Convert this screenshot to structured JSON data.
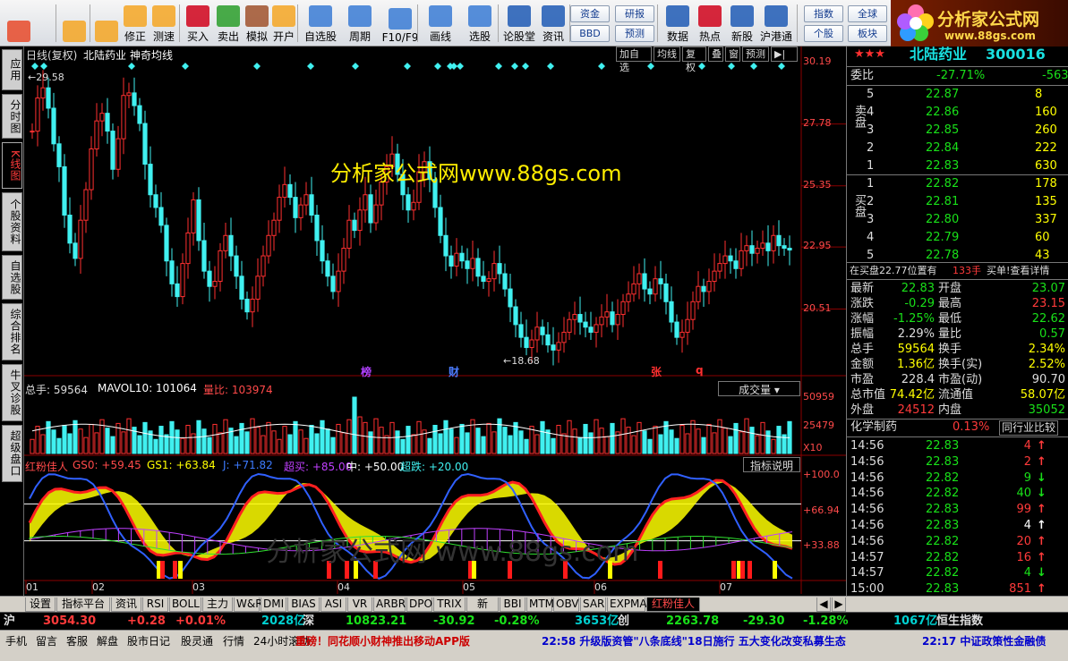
{
  "toolbar": {
    "buttons": [
      {
        "label": "",
        "icon": "grid-icon"
      },
      {
        "label": "",
        "icon": "back-arrow-icon"
      },
      {
        "label": "",
        "icon": "up-down-arrows-icon"
      },
      {
        "label": "修正",
        "icon": "refresh-icon"
      },
      {
        "label": "测速",
        "icon": "clock-icon"
      },
      {
        "label": "买入",
        "icon": "buy-icon"
      },
      {
        "label": "卖出",
        "icon": "sell-icon"
      },
      {
        "label": "模拟",
        "icon": "hammer-icon"
      },
      {
        "label": "开户",
        "icon": "lock-icon"
      },
      {
        "label": "自选股",
        "icon": "star-icon"
      },
      {
        "label": "周期",
        "icon": "period-clock-icon"
      },
      {
        "label": "F10/F9",
        "icon": "f10-icon"
      },
      {
        "label": "画线",
        "icon": "pen-icon"
      },
      {
        "label": "选股",
        "icon": "select-stock-icon"
      },
      {
        "label": "论股堂",
        "icon": "forum-icon"
      },
      {
        "label": "资讯",
        "icon": "news-icon"
      },
      {
        "label": "数据",
        "icon": "pe-icon"
      },
      {
        "label": "热点",
        "icon": "hot-icon"
      },
      {
        "label": "新股",
        "icon": "new-stock-icon"
      },
      {
        "label": "沪港通",
        "icon": "sse-hk-icon"
      }
    ],
    "quick": [
      "资金",
      "研报",
      "BBD",
      "预测",
      "指数",
      "全球",
      "个股",
      "板块"
    ]
  },
  "logo": {
    "title": "分析家公式网",
    "url": "www.88gs.com"
  },
  "side_tabs": [
    "应用",
    "分时图",
    "K线图",
    "个股资料",
    "自选股",
    "综合排名",
    "牛叉诊股",
    "超级盘口"
  ],
  "chart_header": {
    "mode": "日线(复权)",
    "stock": "北陆药业",
    "indicator": "神奇均线",
    "buttons": [
      "加自选",
      "均线",
      "复权",
      "叠",
      "窗",
      "预测"
    ]
  },
  "watermark": "分析家公式网www.88gs.com",
  "watermark2": "分析家公式网  www.88gs.com",
  "price_axis": [
    "30.19",
    "27.78",
    "25.35",
    "22.95",
    "20.51"
  ],
  "price_marks": {
    "high": "29.58",
    "low": "18.68"
  },
  "event_marks": [
    {
      "t": "榜",
      "color": "#b040ff"
    },
    {
      "t": "财",
      "color": "#4a7bff"
    },
    {
      "t": "张",
      "color": "#ff3030"
    },
    {
      "t": "q",
      "color": "#ff3030"
    }
  ],
  "volume_header": {
    "total": "总手: 59564",
    "mavol": "MAVOL10: 101064",
    "ratio": "量比: 103974",
    "dropdown": "成交量"
  },
  "volume_axis": [
    "50959",
    "25479",
    "X10"
  ],
  "ind_header": {
    "name": "红粉佳人",
    "gs0": "GS0: +59.45",
    "gs1": "GS1: +63.84",
    "j": "J: +71.82",
    "chao": "超买: +85.00",
    "mid": "中: +50.00",
    "chaodie": "超跌: +20.00",
    "help": "指标说明"
  },
  "ind_axis": [
    "+100.0",
    "+66.94",
    "+33.88"
  ],
  "months": [
    "01",
    "02",
    "03",
    "04",
    "05",
    "06",
    "07"
  ],
  "quote": {
    "stars": "★★★",
    "name": "北陆药业",
    "code": "300016",
    "webi_label": "委比",
    "webi": "-27.71%",
    "webi2": "-563",
    "sell_label": "卖盘",
    "buy_label": "买盘",
    "sell": [
      [
        "5",
        "22.87",
        "8"
      ],
      [
        "4",
        "22.86",
        "160"
      ],
      [
        "3",
        "22.85",
        "260"
      ],
      [
        "2",
        "22.84",
        "222"
      ],
      [
        "1",
        "22.83",
        "630"
      ]
    ],
    "buy": [
      [
        "1",
        "22.82",
        "178"
      ],
      [
        "2",
        "22.81",
        "135"
      ],
      [
        "3",
        "22.80",
        "337"
      ],
      [
        "4",
        "22.79",
        "60"
      ],
      [
        "5",
        "22.78",
        "43"
      ]
    ],
    "note": "在买盘22.77位置有",
    "note_val": "133手",
    "note2": "买单!查看详情",
    "stats": [
      [
        "最新",
        "22.83",
        "开盘",
        "23.07"
      ],
      [
        "涨跌",
        "-0.29",
        "最高",
        "23.15"
      ],
      [
        "涨幅",
        "-1.25%",
        "最低",
        "22.62"
      ],
      [
        "振幅",
        "2.29%",
        "量比",
        "0.57"
      ],
      [
        "总手",
        "59564",
        "换手",
        "2.34%"
      ],
      [
        "金额",
        "1.36亿",
        "换手(实)",
        "2.52%"
      ],
      [
        "市盈",
        "228.4",
        "市盈(动)",
        "90.70"
      ],
      [
        "总市值",
        "74.42亿",
        "流通值",
        "58.07亿"
      ],
      [
        "外盘",
        "24512",
        "内盘",
        "35052"
      ]
    ],
    "sector": "化学制药",
    "sector_pct": "0.13%",
    "sector_cmp": "同行业比较",
    "ticks": [
      [
        "14:56",
        "22.83",
        "4",
        "up"
      ],
      [
        "14:56",
        "22.83",
        "2",
        "up"
      ],
      [
        "14:56",
        "22.82",
        "9",
        "down"
      ],
      [
        "14:56",
        "22.82",
        "40",
        "down"
      ],
      [
        "14:56",
        "22.83",
        "99",
        "up"
      ],
      [
        "14:56",
        "22.83",
        "4",
        "flat"
      ],
      [
        "14:56",
        "22.82",
        "20",
        "up"
      ],
      [
        "14:57",
        "22.82",
        "16",
        "up"
      ],
      [
        "14:57",
        "22.82",
        "4",
        "down"
      ],
      [
        "15:00",
        "22.83",
        "851",
        "up"
      ]
    ],
    "bottom_tabs": [
      "细",
      "诊",
      "分",
      "筹",
      "怡",
      "财"
    ]
  },
  "bottom_tabs": [
    "设置",
    "指标平台",
    "资讯",
    "RSI",
    "BOLL",
    "主力",
    "W&R",
    "DMI",
    "BIAS",
    "ASI",
    "VR",
    "ARBR",
    "DPO",
    "TRIX",
    "新DMA",
    "BBI",
    "MTM",
    "OBV",
    "SAR",
    "EXPMA",
    "红粉佳人"
  ],
  "index_bar": {
    "sh": "沪",
    "sh_val": "3054.30",
    "sh_chg": "+0.28",
    "sh_pct": "+0.01%",
    "sh_amt": "2028亿",
    "sz": "深",
    "sz_val": "10823.21",
    "sz_chg": "-30.92",
    "sz_pct": "-0.28%",
    "sz_amt": "3653亿",
    "cy": "创",
    "cy_val": "2263.78",
    "cy_chg": "-29.30",
    "cy_pct": "-1.28%",
    "cy_amt": "1067亿",
    "hs": "恒生指数"
  },
  "status": {
    "items": [
      "手机",
      "留言",
      "客服",
      "解盘",
      "股市日记",
      "股灵通",
      "行情",
      "24小时滚动"
    ],
    "ticker1": "重磅！同花顺小财神推出移动APP版",
    "ticker2": "22:58 升级版资管\"八条底线\"18日施行 五大变化改变私募生态",
    "ticker3": "22:17 中证政策性金融债"
  },
  "colors": {
    "up": "#ff3030",
    "down": "#40f0f0",
    "yellow": "#ffff00",
    "magenta": "#c040ff",
    "blue": "#3060ff",
    "green": "#30e030"
  }
}
